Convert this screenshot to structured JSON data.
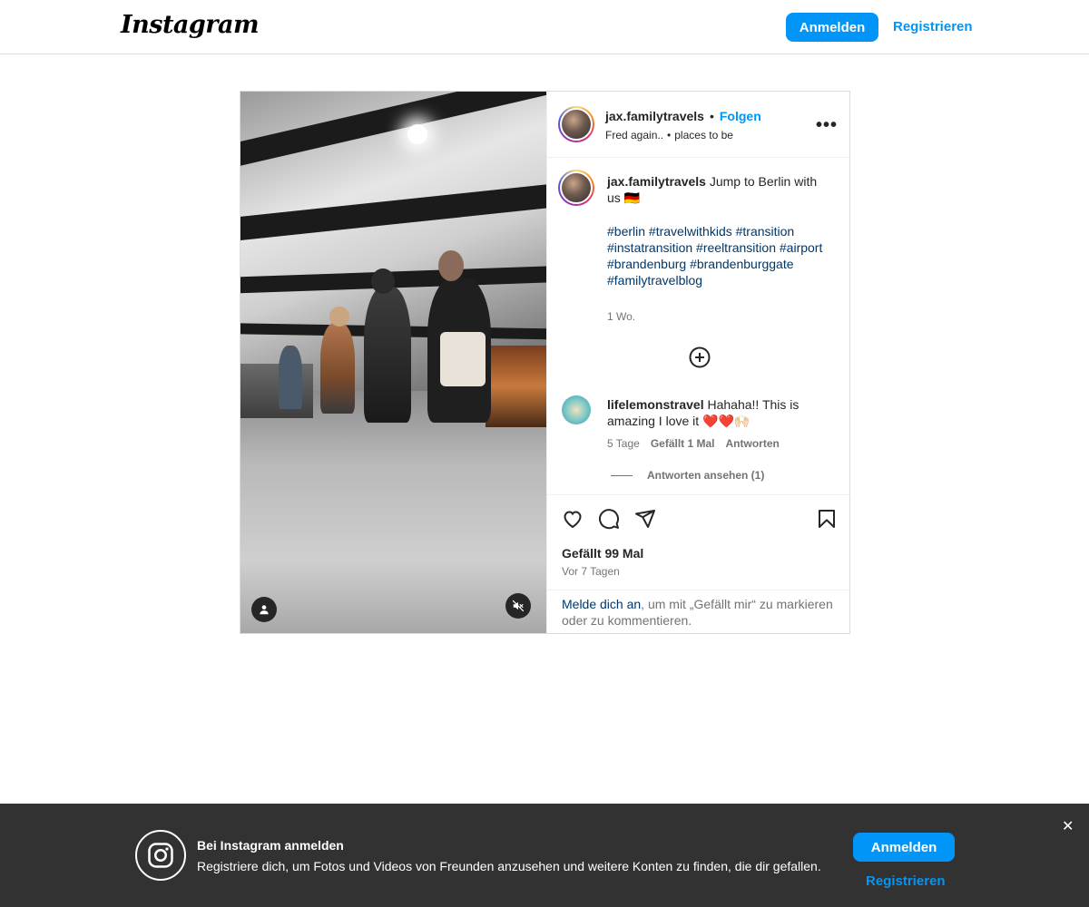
{
  "header": {
    "logo_text": "Instagram",
    "login_label": "Anmelden",
    "register_label": "Registrieren"
  },
  "post": {
    "author": "jax.familytravels",
    "follow_label": "Folgen",
    "audio": "Fred again..",
    "location": "places to be",
    "more_label": "•••",
    "caption_user": "jax.familytravels",
    "caption_text": "Jump to Berlin with us 🇩🇪",
    "hashtags": "#berlin #travelwithkids #transition #instatransition #reeltransition #airport #brandenburg #brandenburggate #familytravelblog",
    "caption_age": "1 Wo.",
    "comment": {
      "user": "lifelemonstravel",
      "text": "Hahaha!! This is amazing I love it ❤️❤️🙌🏻",
      "age": "5 Tage",
      "likes": "Gefällt 1 Mal",
      "reply": "Antworten"
    },
    "view_replies": "Antworten ansehen (1)",
    "likes_text": "Gefällt 99 Mal",
    "time_text": "Vor 7 Tagen",
    "login_prompt_link": "Melde dich an",
    "login_prompt_rest": ", um mit „Gefällt mir“ zu markieren oder zu kommentieren."
  },
  "banner": {
    "title": "Bei Instagram anmelden",
    "text": "Registriere dich, um Fotos und Videos von Freunden anzusehen und weitere Konten zu finden, die dir gefallen.",
    "login_label": "Anmelden",
    "register_label": "Registrieren",
    "close_label": "✕"
  },
  "colors": {
    "accent": "#0095f6",
    "link": "#00376b",
    "banner_bg": "#323232"
  },
  "icons": [
    "heart-icon",
    "comment-icon",
    "share-icon",
    "bookmark-icon",
    "plus-circle-icon",
    "user-tag-icon",
    "mute-icon",
    "instagram-icon",
    "close-icon"
  ]
}
